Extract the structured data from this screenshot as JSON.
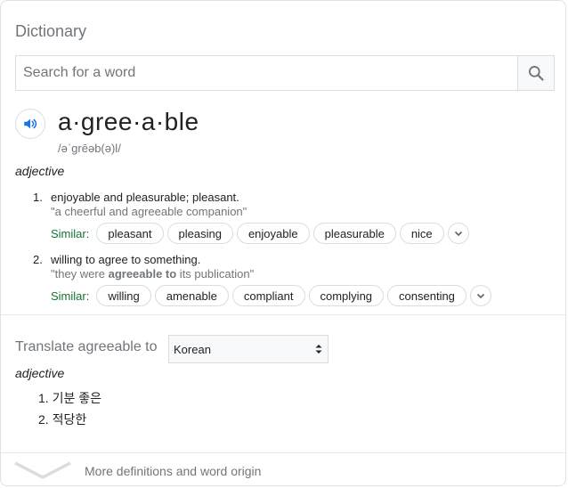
{
  "header": {
    "title": "Dictionary"
  },
  "search": {
    "placeholder": "Search for a word",
    "value": ""
  },
  "entry": {
    "word": "a·gree·a·ble",
    "phonetic": "/əˈɡrēəb(ə)l/",
    "part_of_speech": "adjective",
    "definitions": [
      {
        "number": "1.",
        "text": "enjoyable and pleasurable; pleasant.",
        "example": "\"a cheerful and agreeable companion\"",
        "similar_label": "Similar:",
        "similar": [
          "pleasant",
          "pleasing",
          "enjoyable",
          "pleasurable",
          "nice"
        ]
      },
      {
        "number": "2.",
        "text": "willing to agree to something.",
        "example_before": "\"they were ",
        "example_bold": "agreeable to",
        "example_after": " its publication\"",
        "similar_label": "Similar:",
        "similar": [
          "willing",
          "amenable",
          "compliant",
          "complying",
          "consenting"
        ]
      }
    ]
  },
  "translate": {
    "label": "Translate agreeable to",
    "language": "Korean",
    "part_of_speech": "adjective",
    "items": [
      "1. 기분 좋은",
      "2. 적당한"
    ]
  },
  "footer": {
    "more_label": "More definitions and word origin"
  },
  "icons": {
    "search": "search-icon",
    "speaker": "speaker-icon",
    "expand": "chevron-down-icon",
    "select_arrows": "up-down-arrows-icon"
  },
  "colors": {
    "accent_blue": "#1a73e8",
    "similar_green": "#137333",
    "muted": "#70757a"
  }
}
